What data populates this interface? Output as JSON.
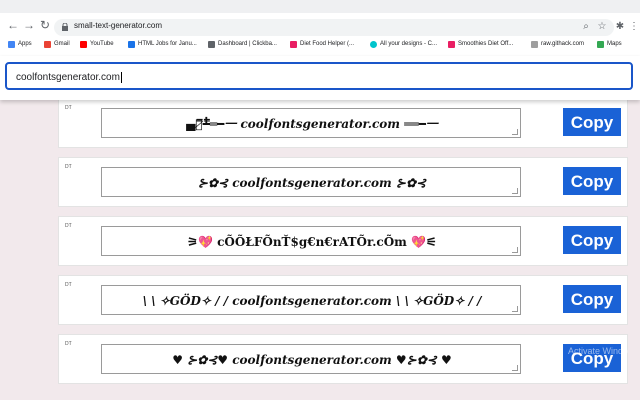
{
  "browser": {
    "url": "small-text-generator.com",
    "bookmarks": [
      {
        "label": "Apps",
        "color": "#4285f4"
      },
      {
        "label": "Gmail",
        "color": "#ea4335"
      },
      {
        "label": "YouTube",
        "color": "#ff0000"
      },
      {
        "label": "HTML Jobs for Janu...",
        "color": "#1a73e8"
      },
      {
        "label": "Dashboard | Clickba...",
        "color": "#5f6368"
      },
      {
        "label": "Diet Food Helper (...",
        "color": "#e91e63"
      },
      {
        "label": "All your designs - C...",
        "color": "#00c4cc"
      },
      {
        "label": "Smoothies Diet Off...",
        "color": "#e91e63"
      },
      {
        "label": "raw.githack.com",
        "color": "#9e9e9e"
      },
      {
        "label": "Maps",
        "color": "#34a853"
      }
    ]
  },
  "search": {
    "value": "coolfontsgenerator.com"
  },
  "cards": [
    {
      "tag": "DT",
      "text": "▄︻̷̿┻̿═━一 coolfontsgenerator.com ══━一",
      "copy": "Copy"
    },
    {
      "tag": "DT",
      "text": "⊱✿⊰ coolfontsgenerator.com ⊱✿⊰",
      "copy": "Copy"
    },
    {
      "tag": "DT",
      "text": "⚞💖 cÕÕŁFÕnŤ$g€n€rATÕr.cÕm 💖⚟",
      "copy": "Copy"
    },
    {
      "tag": "DT",
      "text": "\\ \\ ✧GÖD✧ / /  coolfontsgenerator.com  \\ \\ ✧GÖD✧ / /",
      "copy": "Copy"
    },
    {
      "tag": "DT",
      "text": "♥ ⊱✿⊰♥ coolfontsgenerator.com ♥⊱✿⊰ ♥",
      "copy": "Copy"
    }
  ],
  "watermark": "Activate Windo"
}
